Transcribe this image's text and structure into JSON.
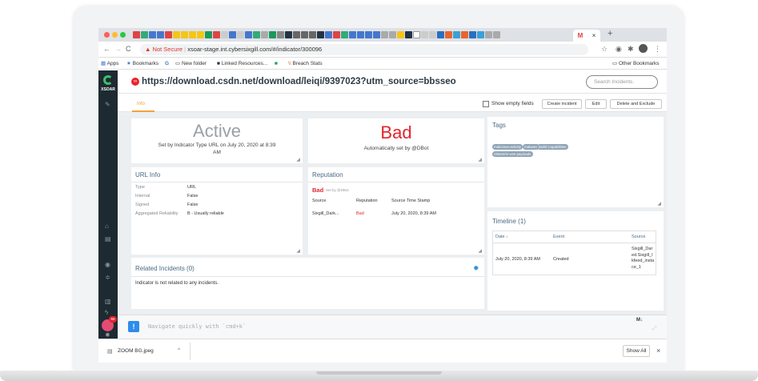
{
  "browser": {
    "tab_title": "M",
    "new_tab": "+",
    "close_tab": "×",
    "security": "Not Secure",
    "url": "xsoar-stage.int.cybersixgill.com/#/indicator/300096",
    "bookmarks": [
      "Apps",
      "Bookmarks",
      "New folder",
      "Linked Resources...",
      "Breach Stats"
    ],
    "other_bookmarks": "Other Bookmarks"
  },
  "app": {
    "logo": "XSOAR",
    "title": "https://download.csdn.net/download/leiqi/9397023?utm_source=bbsseo",
    "search_placeholder": "Search Incidents.",
    "help": "?",
    "info_tab": "Info",
    "show_empty": "Show empty fields",
    "buttons": [
      "Create incident",
      "Edit",
      "Delete and Exclude"
    ]
  },
  "status_card": {
    "status": "Active",
    "subtitle": "Set by Indicator Type URL on July 20, 2020 at 8:39 AM"
  },
  "verdict_card": {
    "verdict": "Bad",
    "subtitle": "Automatically set by @DBot"
  },
  "tags_card": {
    "title": "Tags",
    "tags": [
      "malicious-activity",
      "malware",
      "Build Capabilities",
      "Obtain/re-use payloads"
    ]
  },
  "url_info": {
    "title": "URL Info",
    "rows": [
      {
        "k": "Type",
        "v": "URL"
      },
      {
        "k": "Internal",
        "v": "False"
      },
      {
        "k": "Signed",
        "v": "False"
      },
      {
        "k": "Aggregated Reliability",
        "v": "B - Usually reliable"
      }
    ]
  },
  "reputation": {
    "title": "Reputation",
    "verdict": "Bad",
    "set_by": "Set by @DBot",
    "headers": [
      "Source",
      "Reputation",
      "Source Time Stamp"
    ],
    "row": [
      "Sixgill_Dark...",
      "Bad",
      "July 20, 2020, 8:39 AM"
    ]
  },
  "timeline": {
    "title": "Timeline (1)",
    "headers": [
      "Date ↓",
      "Event",
      "Source"
    ],
    "row": [
      "July 20, 2020, 8:39 AM",
      "Created",
      "Sixgill_Dar ed.Sixgill_I kfeed_insta ce_1"
    ]
  },
  "related": {
    "title": "Related Incidents (0)",
    "text": "Indicator is not related to any incidents."
  },
  "cli": {
    "placeholder": "Navigate quickly with `cmd+k`",
    "badge": "66",
    "bang": "!",
    "md": "M↓"
  },
  "downloads": {
    "file": "ZOOM BG.jpeg",
    "show_all": "Show All",
    "close": "×"
  },
  "colors": {
    "accent": "#f2a23a",
    "bad": "#e3242b",
    "sidebar": "#1e2a32",
    "link": "#4a6b85"
  }
}
